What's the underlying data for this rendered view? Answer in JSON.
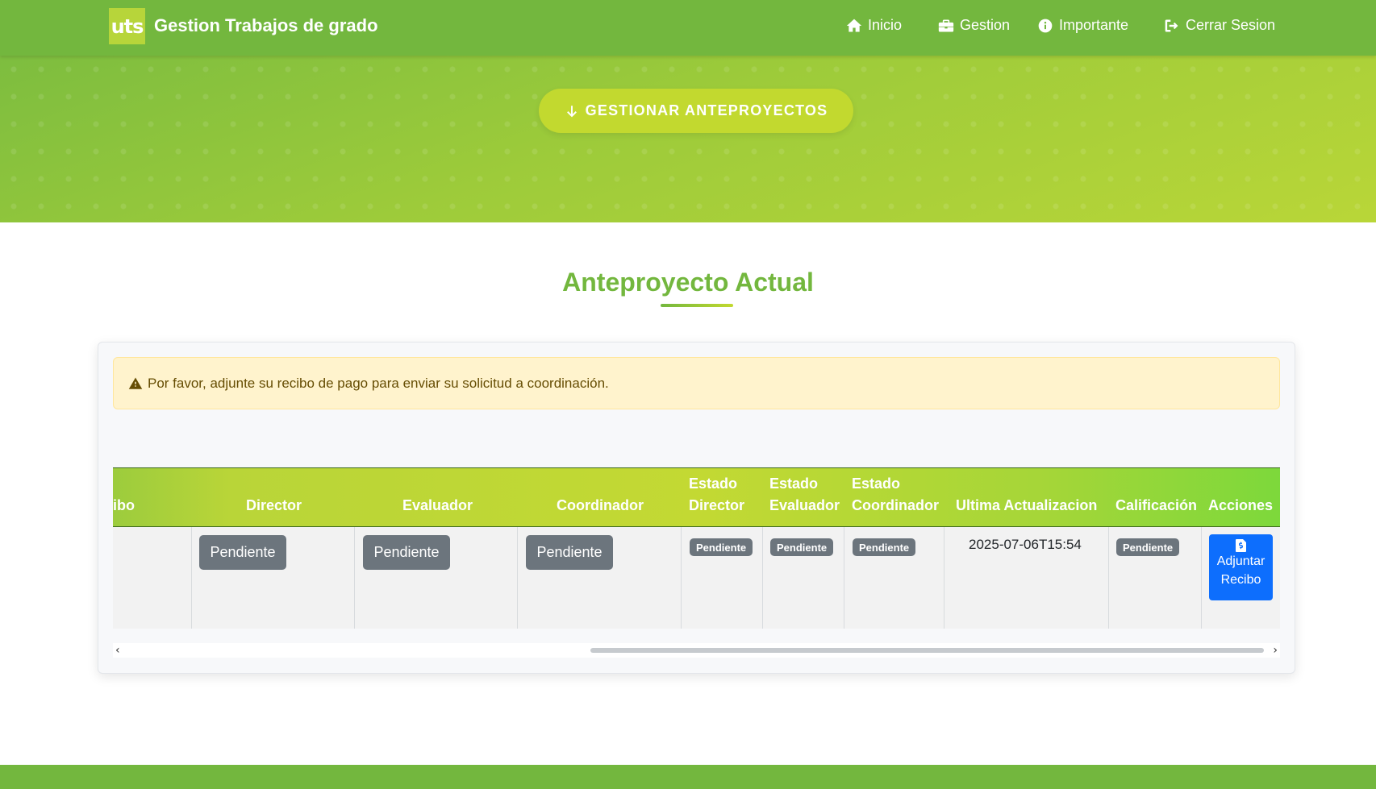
{
  "navbar": {
    "logo_text": "uts",
    "brand_title": "Gestion Trabajos de grado",
    "links": [
      {
        "label": "Inicio",
        "icon": "home-icon"
      },
      {
        "label": "Gestion",
        "icon": "briefcase-icon"
      },
      {
        "label": "Importante",
        "icon": "info-circle-icon"
      },
      {
        "label": "Cerrar Sesion",
        "icon": "sign-out-icon"
      }
    ]
  },
  "hero": {
    "button_label": "GESTIONAR ANTEPROYECTOS",
    "button_icon": "arrow-down-icon"
  },
  "section": {
    "title": "Anteproyecto Actual"
  },
  "alert": {
    "icon": "warning-icon",
    "text": "Por favor, adjunte su recibo de pago para enviar su solicitud a coordinación."
  },
  "table": {
    "headers": {
      "recibo_partial": "ibo",
      "director": "Director",
      "evaluador": "Evaluador",
      "coordinador": "Coordinador",
      "estado_director_1": "Estado",
      "estado_director_2": "Director",
      "estado_evaluador_1": "Estado",
      "estado_evaluador_2": "Evaluador",
      "estado_coordinador_1": "Estado",
      "estado_coordinador_2": "Coordinador",
      "ultima_actualizacion": "Ultima Actualizacion",
      "calificacion": "Calificación",
      "acciones": "Acciones"
    },
    "row": {
      "director": "Pendiente",
      "evaluador": "Pendiente",
      "coordinador": "Pendiente",
      "estado_director": "Pendiente",
      "estado_evaluador": "Pendiente",
      "estado_coordinador": "Pendiente",
      "ultima_actualizacion": "2025-07-06T15:54",
      "calificacion": "Pendiente",
      "accion_line1": "Adjuntar",
      "accion_line2": "Recibo",
      "accion_icon": "file-invoice-dollar-icon"
    }
  },
  "scrollbar": {
    "left_arrow": "‹",
    "right_arrow": "›",
    "position": 0.4
  },
  "colors": {
    "brand_green": "#73b73e",
    "accent_lime": "#c2d92f",
    "primary_blue": "#0d6efd",
    "badge_gray": "#6c757d",
    "alert_bg": "#fff3cd"
  }
}
